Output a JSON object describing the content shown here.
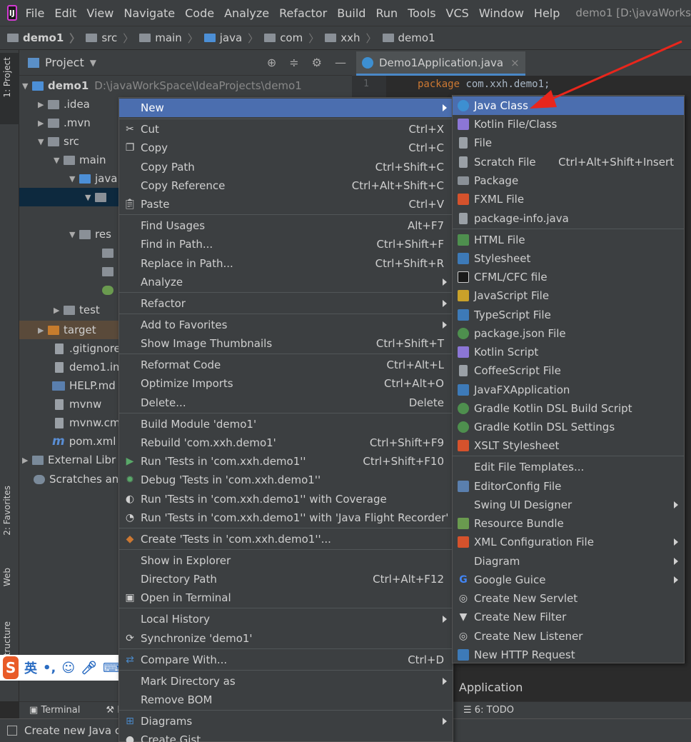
{
  "menubar": {
    "logo": "IJ",
    "items": [
      "File",
      "Edit",
      "View",
      "Navigate",
      "Code",
      "Analyze",
      "Refactor",
      "Build",
      "Run",
      "Tools",
      "VCS",
      "Window",
      "Help"
    ],
    "window_title": "demo1 [D:\\javaWorks"
  },
  "breadcrumb": [
    "demo1",
    "src",
    "main",
    "java",
    "com",
    "xxh",
    "demo1"
  ],
  "stripe": {
    "project_tab": "1: Project",
    "favorites_tab": "2: Favorites",
    "web_tab": "Web",
    "structure_tab": "tructure"
  },
  "project_panel": {
    "title": "Project",
    "tree": {
      "root": "demo1",
      "root_path": "D:\\javaWorkSpace\\IdeaProjects\\demo1",
      "idea": ".idea",
      "mvn": ".mvn",
      "src": "src",
      "main": "main",
      "java": "java",
      "resources": "res",
      "test": "test",
      "target": "target",
      "gitignore": ".gitignore",
      "demo1_iml": "demo1.im",
      "help_md": "HELP.md",
      "mvnw": "mvnw",
      "mvnw_cmd": "mvnw.cm",
      "pom": "pom.xml",
      "external_libs": "External Libr",
      "scratches": "Scratches an"
    }
  },
  "editor": {
    "tab_label": "Demo1Application.java",
    "tab_close": "×",
    "line_number": "1",
    "code_keyword": "package",
    "code_rest": " com.xxh.demo1;"
  },
  "ime": {
    "logo": "S",
    "lang": "英"
  },
  "context_menu": {
    "new": "New",
    "cut": "Cut",
    "cut_sc": "Ctrl+X",
    "copy": "Copy",
    "copy_sc": "Ctrl+C",
    "copy_path": "Copy Path",
    "copy_path_sc": "Ctrl+Shift+C",
    "copy_reference": "Copy Reference",
    "copy_reference_sc": "Ctrl+Alt+Shift+C",
    "paste": "Paste",
    "paste_sc": "Ctrl+V",
    "find_usages": "Find Usages",
    "find_usages_sc": "Alt+F7",
    "find_in_path": "Find in Path...",
    "find_in_path_sc": "Ctrl+Shift+F",
    "replace_in_path": "Replace in Path...",
    "replace_in_path_sc": "Ctrl+Shift+R",
    "analyze": "Analyze",
    "refactor": "Refactor",
    "add_to_favorites": "Add to Favorites",
    "show_thumbnails": "Show Image Thumbnails",
    "show_thumbnails_sc": "Ctrl+Shift+T",
    "reformat_code": "Reformat Code",
    "reformat_code_sc": "Ctrl+Alt+L",
    "optimize_imports": "Optimize Imports",
    "optimize_imports_sc": "Ctrl+Alt+O",
    "delete": "Delete...",
    "delete_sc": "Delete",
    "build_module": "Build Module 'demo1'",
    "rebuild": "Rebuild 'com.xxh.demo1'",
    "rebuild_sc": "Ctrl+Shift+F9",
    "run_tests": "Run 'Tests in 'com.xxh.demo1''",
    "run_tests_sc": "Ctrl+Shift+F10",
    "debug_tests": "Debug 'Tests in 'com.xxh.demo1''",
    "run_coverage": "Run 'Tests in 'com.xxh.demo1'' with Coverage",
    "run_jfr": "Run 'Tests in 'com.xxh.demo1'' with 'Java Flight Recorder'",
    "create_tests": "Create 'Tests in 'com.xxh.demo1''...",
    "show_in_explorer": "Show in Explorer",
    "directory_path": "Directory Path",
    "directory_path_sc": "Ctrl+Alt+F12",
    "open_in_terminal": "Open in Terminal",
    "local_history": "Local History",
    "synchronize": "Synchronize 'demo1'",
    "compare_with": "Compare With...",
    "compare_with_sc": "Ctrl+D",
    "mark_directory": "Mark Directory as",
    "remove_bom": "Remove BOM",
    "diagrams": "Diagrams",
    "create_gist": "Create Gist..."
  },
  "new_submenu": {
    "java_class": "Java Class",
    "kotlin_file": "Kotlin File/Class",
    "file": "File",
    "scratch_file": "Scratch File",
    "scratch_file_sc": "Ctrl+Alt+Shift+Insert",
    "package": "Package",
    "fxml_file": "FXML File",
    "package_info": "package-info.java",
    "html_file": "HTML File",
    "stylesheet": "Stylesheet",
    "cfml": "CFML/CFC file",
    "javascript": "JavaScript File",
    "typescript": "TypeScript File",
    "package_json": "package.json File",
    "kotlin_script": "Kotlin Script",
    "coffeescript": "CoffeeScript File",
    "javafx_app": "JavaFXApplication",
    "gradle_kotlin_build": "Gradle Kotlin DSL Build Script",
    "gradle_kotlin_settings": "Gradle Kotlin DSL Settings",
    "xslt": "XSLT Stylesheet",
    "edit_templates": "Edit File Templates...",
    "editorconfig": "EditorConfig File",
    "swing_ui": "Swing UI Designer",
    "resource_bundle": "Resource Bundle",
    "xml_config": "XML Configuration File",
    "diagram": "Diagram",
    "google_guice": "Google Guice",
    "servlet": "Create New Servlet",
    "filter": "Create New Filter",
    "listener": "Create New Listener",
    "http_request": "New HTTP Request"
  },
  "bottom": {
    "terminal": "Terminal",
    "build_partial": "B",
    "todo": "6: TODO",
    "application": "Application",
    "status": "Create new Java cl"
  },
  "colors": {
    "selection": "#4b6eaf",
    "panel": "#3c3f41",
    "editor_bg": "#2b2b2b",
    "arrow": "#e8261c"
  }
}
